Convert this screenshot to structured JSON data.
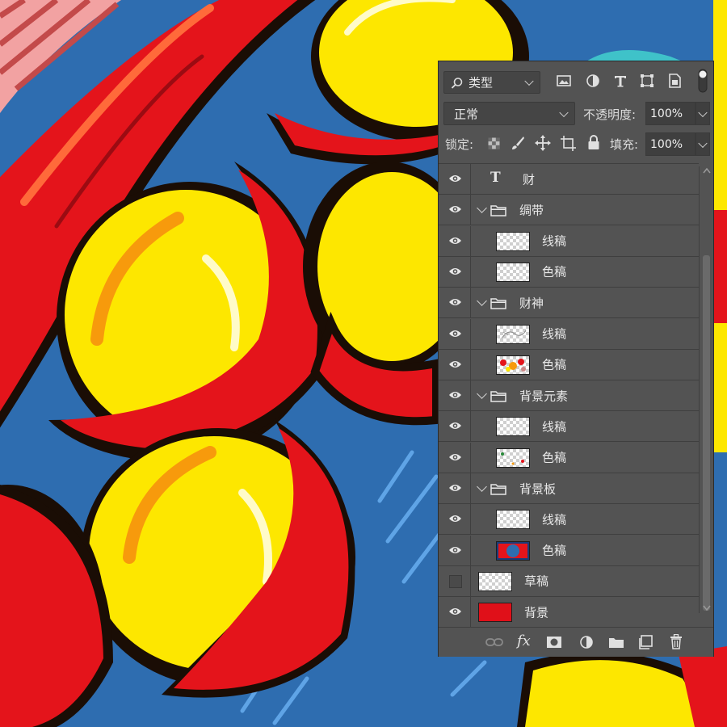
{
  "colors": {
    "panel_bg": "#535353",
    "art_red": "#e4141b",
    "art_yellow": "#fde700",
    "art_orange": "#f79a0c",
    "art_blue": "#2e6db0",
    "art_outline": "#1a0d05",
    "background_swatch": "#e01019"
  },
  "filter_bar": {
    "kind_label": "类型",
    "kind_icon": "search-icon",
    "filter_icons": [
      "image-filter-icon",
      "adjustment-filter-icon",
      "type-filter-icon",
      "shape-filter-icon",
      "smart-object-filter-icon",
      "filter-toggle-icon"
    ]
  },
  "blend": {
    "mode": "正常",
    "opacity_label": "不透明度:",
    "opacity_value": "100%"
  },
  "lock": {
    "label": "锁定:",
    "icons": [
      "lock-transparent-icon",
      "lock-image-icon",
      "lock-position-icon",
      "lock-artboard-icon",
      "lock-all-icon"
    ],
    "fill_label": "填充:",
    "fill_value": "100%"
  },
  "layers": [
    {
      "name": "财",
      "type": "text",
      "visible": true,
      "indent": 0
    },
    {
      "name": "绸带",
      "type": "group",
      "visible": true,
      "expanded": true,
      "indent": 0
    },
    {
      "name": "线稿",
      "type": "layer",
      "visible": true,
      "indent": 1,
      "thumb": "transparent"
    },
    {
      "name": "色稿",
      "type": "layer",
      "visible": true,
      "indent": 1,
      "thumb": "transparent"
    },
    {
      "name": "财神",
      "type": "group",
      "visible": true,
      "expanded": true,
      "indent": 0
    },
    {
      "name": "线稿",
      "type": "layer",
      "visible": true,
      "indent": 1,
      "thumb": "sketch"
    },
    {
      "name": "色稿",
      "type": "layer",
      "visible": true,
      "indent": 1,
      "thumb": "figure"
    },
    {
      "name": "背景元素",
      "type": "group",
      "visible": true,
      "expanded": true,
      "indent": 0
    },
    {
      "name": "线稿",
      "type": "layer",
      "visible": true,
      "indent": 1,
      "thumb": "transparent"
    },
    {
      "name": "色稿",
      "type": "layer",
      "visible": true,
      "indent": 1,
      "thumb": "dots"
    },
    {
      "name": "背景板",
      "type": "group",
      "visible": true,
      "expanded": true,
      "indent": 0
    },
    {
      "name": "线稿",
      "type": "layer",
      "visible": true,
      "indent": 1,
      "thumb": "transparent"
    },
    {
      "name": "色稿",
      "type": "layer",
      "visible": true,
      "indent": 1,
      "thumb": "board"
    },
    {
      "name": "草稿",
      "type": "layer",
      "visible": false,
      "indent": 0,
      "thumb": "transparent"
    },
    {
      "name": "背景",
      "type": "layer",
      "visible": true,
      "indent": 0,
      "thumb": "solid-red"
    }
  ],
  "bottom_icons": [
    "link-layers-icon",
    "fx-icon",
    "add-mask-icon",
    "adjustment-layer-icon",
    "new-group-icon",
    "new-layer-icon",
    "delete-layer-icon"
  ]
}
